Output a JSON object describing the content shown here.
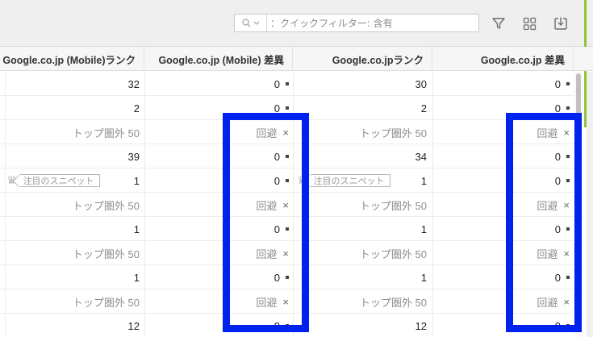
{
  "toolbar": {
    "search_placeholder": "：クイックフィルター: 含有",
    "search_value": "",
    "icons": [
      "search-icon",
      "chevron-down-icon",
      "filter-icon",
      "grid-icon",
      "download-icon"
    ]
  },
  "columns": [
    "Google.co.jp (Mobile)ランク",
    "Google.co.jp (Mobile) 差異",
    "Google.co.jpランク",
    "Google.co.jp 差異"
  ],
  "snippet_label": "注目のスニペット",
  "rows": [
    {
      "m_rank": "32",
      "m_diff": "0",
      "m_mark": "dot",
      "rank": "30",
      "diff": "0",
      "mark": "dot",
      "snippet": false,
      "out_of_top": false
    },
    {
      "m_rank": "2",
      "m_diff": "0",
      "m_mark": "dot",
      "rank": "2",
      "diff": "0",
      "mark": "dot",
      "snippet": false,
      "out_of_top": false
    },
    {
      "m_rank": "トップ圏外 50",
      "m_diff": "回避",
      "m_mark": "x",
      "rank": "トップ圏外 50",
      "diff": "回避",
      "mark": "x",
      "snippet": false,
      "out_of_top": true
    },
    {
      "m_rank": "39",
      "m_diff": "0",
      "m_mark": "dot",
      "rank": "34",
      "diff": "0",
      "mark": "dot",
      "snippet": false,
      "out_of_top": false
    },
    {
      "m_rank": "1",
      "m_diff": "0",
      "m_mark": "dot",
      "rank": "1",
      "diff": "0",
      "mark": "dot",
      "snippet": true,
      "out_of_top": false
    },
    {
      "m_rank": "トップ圏外 50",
      "m_diff": "回避",
      "m_mark": "x",
      "rank": "トップ圏外 50",
      "diff": "回避",
      "mark": "x",
      "snippet": false,
      "out_of_top": true
    },
    {
      "m_rank": "1",
      "m_diff": "0",
      "m_mark": "dot",
      "rank": "1",
      "diff": "0",
      "mark": "dot",
      "snippet": false,
      "out_of_top": false
    },
    {
      "m_rank": "トップ圏外 50",
      "m_diff": "回避",
      "m_mark": "x",
      "rank": "トップ圏外 50",
      "diff": "回避",
      "mark": "x",
      "snippet": false,
      "out_of_top": true
    },
    {
      "m_rank": "1",
      "m_diff": "0",
      "m_mark": "dot",
      "rank": "1",
      "diff": "0",
      "mark": "dot",
      "snippet": false,
      "out_of_top": false
    },
    {
      "m_rank": "トップ圏外 50",
      "m_diff": "回避",
      "m_mark": "x",
      "rank": "トップ圏外 50",
      "diff": "回避",
      "mark": "x",
      "snippet": false,
      "out_of_top": true
    },
    {
      "m_rank": "12",
      "m_diff": "0",
      "m_mark": "dot",
      "rank": "12",
      "diff": "0",
      "mark": "dot",
      "snippet": false,
      "out_of_top": false
    }
  ],
  "colors": {
    "highlight": "#0022ee",
    "accent": "#8cc63f"
  }
}
